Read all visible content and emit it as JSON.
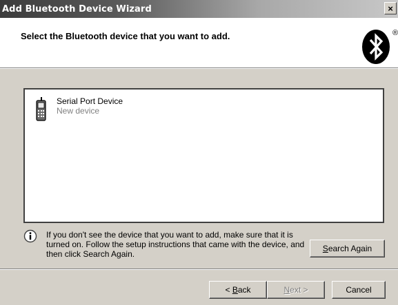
{
  "window": {
    "title": "Add Bluetooth Device Wizard",
    "close_label": "×"
  },
  "header": {
    "title": "Select the Bluetooth device that you want to add.",
    "logo_icon": "bluetooth-logo-icon",
    "logo_mark": "®"
  },
  "devices": [
    {
      "name": "Serial Port Device",
      "status": "New device",
      "icon": "phone-icon"
    }
  ],
  "info": {
    "icon": "info-icon",
    "text": "If you don't see the device that you want to add, make sure that it is turned on. Follow the setup instructions that came with the device, and then click Search Again."
  },
  "buttons": {
    "search_again": {
      "key": "S",
      "rest": "earch Again"
    },
    "back": {
      "prefix": "< ",
      "key": "B",
      "rest": "ack"
    },
    "next": {
      "key": "N",
      "rest": "ext >"
    },
    "cancel": "Cancel"
  },
  "colors": {
    "dialog_bg": "#d4d0c8",
    "title_bar_start": "#3c3c3c",
    "title_bar_end": "#c8c8c8"
  }
}
